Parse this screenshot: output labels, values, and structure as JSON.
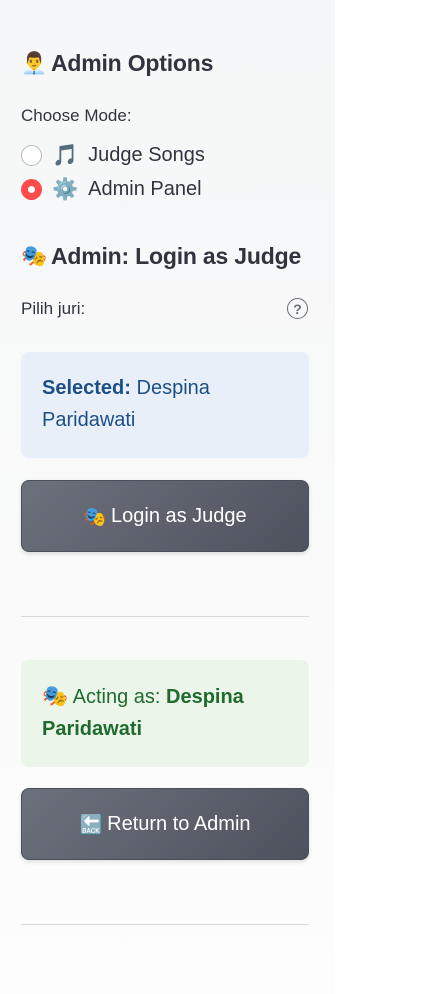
{
  "sidebar": {
    "admin_options": {
      "icon": "👨‍💼",
      "title": "Admin Options"
    },
    "mode": {
      "label": "Choose Mode:",
      "options": [
        {
          "icon": "🎵",
          "label": "Judge Songs",
          "selected": false
        },
        {
          "icon": "⚙️",
          "label": "Admin Panel",
          "selected": true
        }
      ]
    },
    "login_section": {
      "icon": "🎭",
      "title": "Admin: Login as Judge",
      "select_label": "Pilih juri:",
      "help_glyph": "?",
      "selected_prefix": "Selected:",
      "selected_name": "Despina Paridawati",
      "login_button": {
        "icon": "🎭",
        "label": "Login as Judge"
      }
    },
    "acting_section": {
      "icon": "🎭",
      "prefix": "Acting as:",
      "name": "Despina Paridawati",
      "return_button": {
        "icon": "🔙",
        "label": "Return to Admin"
      }
    }
  },
  "colors": {
    "accent": "#ff4b4b",
    "info_blue_bg": "#e8eff9",
    "info_blue_text": "#1c4f85",
    "success_bg": "#ecf5ea",
    "success_text": "#1f6b2e",
    "button_bg": "#5a5e69"
  }
}
